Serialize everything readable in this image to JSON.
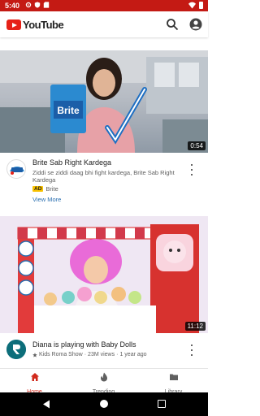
{
  "status_bar": {
    "time": "5:40"
  },
  "app_bar": {
    "brand": "YouTube"
  },
  "videos": [
    {
      "title": "Brite Sab Right Kardega",
      "description": "Ziddi se ziddi daag bhi fight kardega, Brite Sab Right Kardega",
      "ad_badge": "AD",
      "channel": "Brite",
      "view_more": "View More",
      "duration": "0:54",
      "thumbnail_text": "Brite"
    },
    {
      "title": "Diana is playing with Baby Dolls",
      "channel": "Kids Roma Show",
      "views": "23M views",
      "separator": "·",
      "age": "1 year ago",
      "duration": "11:12"
    }
  ],
  "bottom_nav": [
    {
      "label": "Home",
      "active": true
    },
    {
      "label": "Trending",
      "active": false
    },
    {
      "label": "Library",
      "active": false
    }
  ],
  "colors": {
    "accent": "#e62117",
    "status_bar": "#c41a14",
    "link": "#2a6fb0",
    "ad_badge": "#f9c200"
  }
}
